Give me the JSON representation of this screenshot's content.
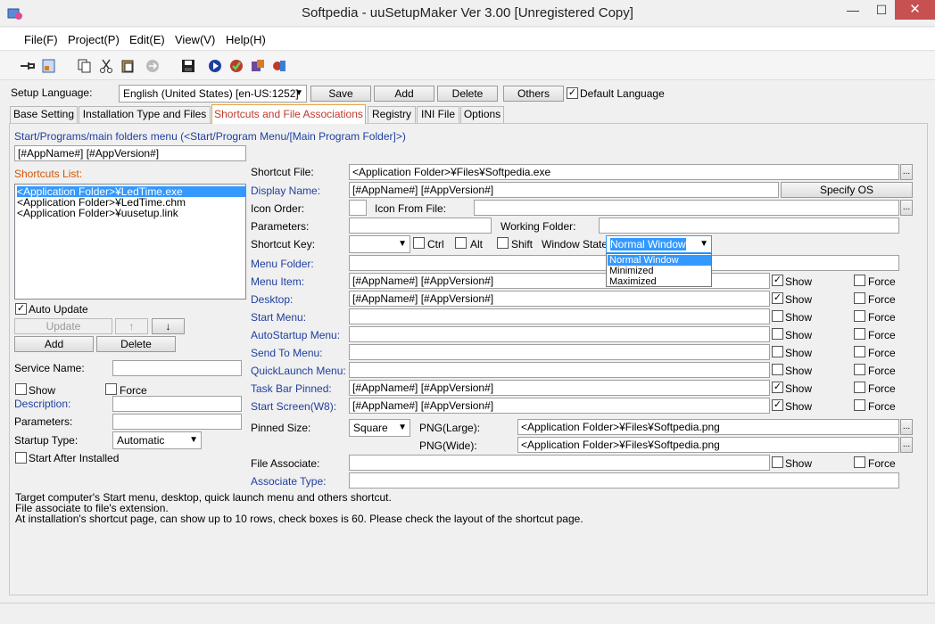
{
  "window": {
    "title": "Softpedia - uuSetupMaker Ver 3.00 [Unregistered Copy]",
    "minimize": "—",
    "maximize": "☐",
    "close": "✕"
  },
  "menu": [
    "File(F)",
    "Project(P)",
    "Edit(E)",
    "View(V)",
    "Help(H)"
  ],
  "language": {
    "label": "Setup Language:",
    "value": "English (United States) [en-US:1252]",
    "save": "Save",
    "add": "Add",
    "delete": "Delete",
    "others": "Others",
    "default_label": "Default Language"
  },
  "tabs": [
    "Base Setting",
    "Installation Type and Files",
    "Shortcuts and File Associations",
    "Registry",
    "INI File",
    "Options"
  ],
  "left": {
    "start_menu_label": "Start/Programs/main folders menu (<Start/Program Menu/[Main Program Folder]>)",
    "start_menu_value": "[#AppName#] [#AppVersion#]",
    "shortcuts_label": "Shortcuts List:",
    "shortcuts": [
      "<Application Folder>¥LedTime.exe",
      "<Application Folder>¥LedTime.chm",
      "<Application Folder>¥uusetup.link"
    ],
    "auto_update": "Auto Update",
    "update": "Update",
    "up": "↑",
    "down": "↓",
    "add": "Add",
    "delete": "Delete",
    "service_name": "Service Name:",
    "show": "Show",
    "force": "Force",
    "description": "Description:",
    "parameters": "Parameters:",
    "startup_type": "Startup Type:",
    "startup_value": "Automatic",
    "start_after": "Start After Installed"
  },
  "right": {
    "shortcut_file_label": "Shortcut File:",
    "shortcut_file_value": "<Application Folder>¥Files¥Softpedia.exe",
    "browse": "...",
    "display_name_label": "Display Name:",
    "display_name_value": "[#AppName#] [#AppVersion#]",
    "specify_os": "Specify OS",
    "icon_order_label": "Icon Order:",
    "icon_from_file_label": "Icon From File:",
    "parameters_label": "Parameters:",
    "working_folder_label": "Working Folder:",
    "shortcut_key_label": "Shortcut Key:",
    "ctrl": "Ctrl",
    "alt": "Alt",
    "shift": "Shift",
    "window_state_label": "Window State:",
    "window_state_value": "Normal Window",
    "window_state_options": [
      "Normal Window",
      "Minimized",
      "Maximized"
    ],
    "menu_folder_label": "Menu Folder:",
    "rows": [
      {
        "label": "Menu Item:",
        "value": "[#AppName#] [#AppVersion#]",
        "show": true
      },
      {
        "label": "Desktop:",
        "value": "[#AppName#] [#AppVersion#]",
        "show": true
      },
      {
        "label": "Start Menu:",
        "value": "",
        "show": false
      },
      {
        "label": "AutoStartup Menu:",
        "value": "",
        "show": false
      },
      {
        "label": "Send To Menu:",
        "value": "",
        "show": false
      },
      {
        "label": "QuickLaunch Menu:",
        "value": "",
        "show": false
      },
      {
        "label": "Task Bar Pinned:",
        "value": "[#AppName#] [#AppVersion#]",
        "show": true
      },
      {
        "label": "Start Screen(W8):",
        "value": "[#AppName#] [#AppVersion#]",
        "show": true
      }
    ],
    "show": "Show",
    "force": "Force",
    "pinned_size_label": "Pinned Size:",
    "pinned_size_value": "Square",
    "png_large_label": "PNG(Large):",
    "png_large_value": "<Application Folder>¥Files¥Softpedia.png",
    "png_wide_label": "PNG(Wide):",
    "png_wide_value": "<Application Folder>¥Files¥Softpedia.png",
    "file_associate_label": "File Associate:",
    "associate_type_label": "Associate Type:"
  },
  "help_text": [
    "Target computer's Start menu, desktop, quick launch menu and others shortcut.",
    "File associate to file's extension.",
    "At installation's shortcut page, can show up to 10 rows, check boxes is 60. Please check the layout of the shortcut page."
  ],
  "colors": {
    "accent_blue": "#1f3f9f",
    "accent_orange": "#d35400",
    "selection": "#3399ff"
  }
}
